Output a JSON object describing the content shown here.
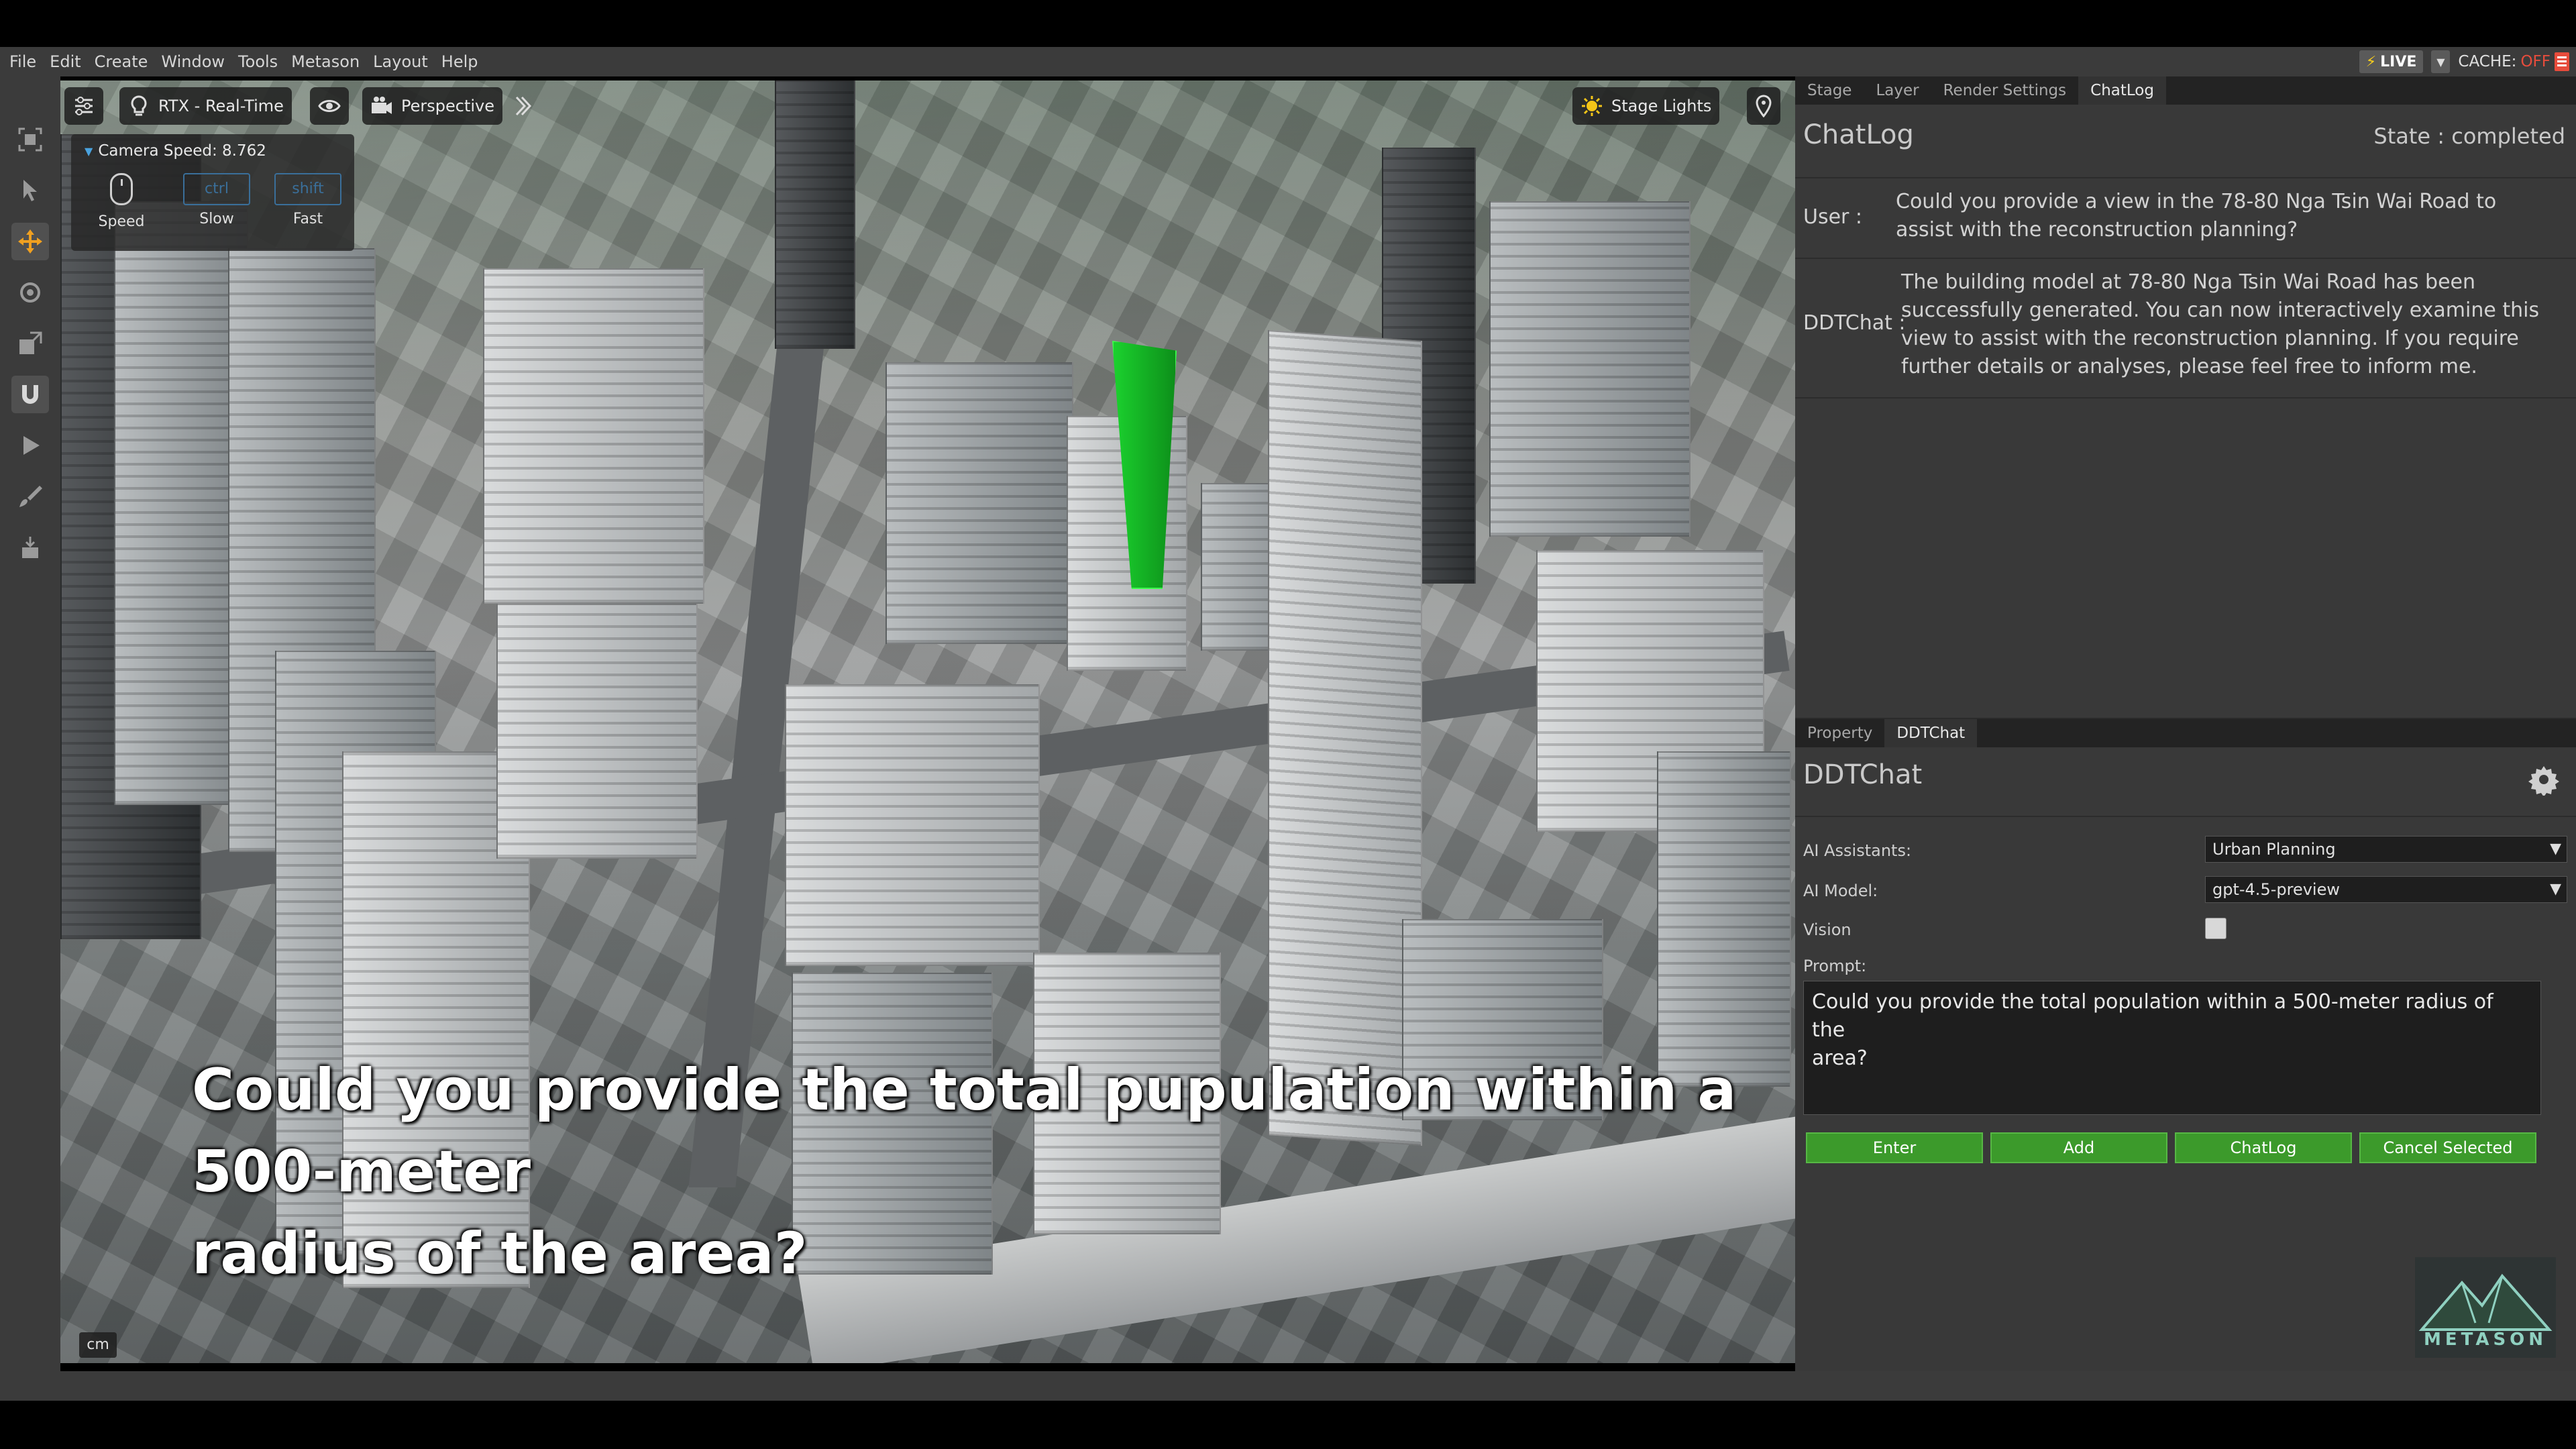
{
  "menubar": {
    "items": [
      "File",
      "Edit",
      "Create",
      "Window",
      "Tools",
      "Metason",
      "Layout",
      "Help"
    ],
    "live_label": "LIVE",
    "cache_label": "CACHE:",
    "cache_state": "OFF",
    "accent_live": "#ffd11a",
    "accent_cache_off": "#e74c3c"
  },
  "left_toolbar": {
    "tools": [
      "frame-icon",
      "select-arrow-icon",
      "move-icon",
      "rotate-icon",
      "scale-icon",
      "snap-magnet-icon",
      "play-icon",
      "paint-brush-icon",
      "physics-icon"
    ],
    "active_tool": "move-icon"
  },
  "viewport": {
    "renderer_label": "RTX - Real-Time",
    "camera_label": "Perspective",
    "stage_lights_label": "Stage Lights",
    "camera_speed_label": "Camera Speed: 8.762",
    "speed_label": "Speed",
    "slow_key": "ctrl",
    "slow_label": "Slow",
    "fast_key": "shift",
    "fast_label": "Fast",
    "unit_label": "cm",
    "subtitle_line1": "Could you provide the total pupulation within a 500-meter",
    "subtitle_line2": "radius of the area?"
  },
  "top_tabs": [
    "Stage",
    "Layer",
    "Render Settings",
    "ChatLog"
  ],
  "top_tabs_active": "ChatLog",
  "chatlog": {
    "title": "ChatLog",
    "state": "State : completed",
    "messages": [
      {
        "role": "User :",
        "text_line1": "Could you provide a view in the 78-80 Nga Tsin Wai Road to",
        "text_line2": "assist with the reconstruction planning?"
      },
      {
        "role": "DDTChat :",
        "text_line1": "The building model at 78-80 Nga Tsin Wai Road has been",
        "text_line2": "successfully generated. You can now interactively examine this",
        "text_line3": "view to assist with the reconstruction planning. If you require",
        "text_line4": "further details or analyses, please feel free to inform me."
      }
    ]
  },
  "bottom_tabs": [
    "Property",
    "DDTChat"
  ],
  "bottom_tabs_active": "DDTChat",
  "ddtchat": {
    "title": "DDTChat",
    "assistants_label": "AI Assistants:",
    "assistants_value": "Urban Planning",
    "model_label": "AI Model:",
    "model_value": "gpt-4.5-preview",
    "vision_label": "Vision",
    "prompt_label": "Prompt:",
    "prompt_line1": "Could you provide the total population within a 500-meter radius of the",
    "prompt_line2": "area?",
    "buttons": [
      "Enter",
      "Add",
      "ChatLog",
      "Cancel Selected"
    ],
    "button_color": "#3c9a2b"
  },
  "logo_text": "METASON"
}
